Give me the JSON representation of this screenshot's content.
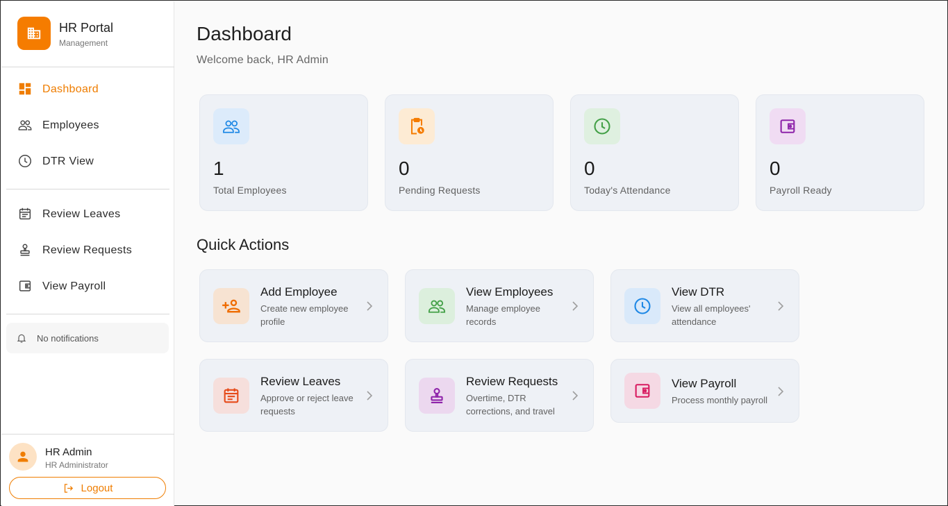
{
  "brand": {
    "title": "HR Portal",
    "subtitle": "Management",
    "color": "#f57c00"
  },
  "nav": {
    "primary": [
      {
        "label": "Dashboard",
        "icon": "dashboard-icon",
        "active": true
      },
      {
        "label": "Employees",
        "icon": "people-icon"
      },
      {
        "label": "DTR View",
        "icon": "clock-icon"
      }
    ],
    "secondary": [
      {
        "label": "Review Leaves",
        "icon": "calendar-icon"
      },
      {
        "label": "Review Requests",
        "icon": "stamp-icon"
      },
      {
        "label": "View Payroll",
        "icon": "wallet-icon"
      }
    ]
  },
  "notifications": {
    "label": "No notifications",
    "icon": "bell-icon"
  },
  "user": {
    "name": "HR Admin",
    "role": "HR Administrator",
    "logout_label": "Logout"
  },
  "header": {
    "title": "Dashboard",
    "subtitle": "Welcome back, HR Admin"
  },
  "stats": [
    {
      "value": "1",
      "label": "Total Employees",
      "icon": "people-icon",
      "color": "#1e88e5"
    },
    {
      "value": "0",
      "label": "Pending Requests",
      "icon": "clipboard-clock-icon",
      "color": "#f57c00"
    },
    {
      "value": "0",
      "label": "Today's Attendance",
      "icon": "clock-icon",
      "color": "#43a047"
    },
    {
      "value": "0",
      "label": "Payroll Ready",
      "icon": "wallet-icon",
      "color": "#8e24aa"
    }
  ],
  "quick_actions": {
    "title": "Quick Actions",
    "items": [
      {
        "title": "Add Employee",
        "desc": "Create new employee profile",
        "icon": "add-person-icon",
        "color": "#ef6c00"
      },
      {
        "title": "View Employees",
        "desc": "Manage employee records",
        "icon": "people-icon",
        "color": "#43a047"
      },
      {
        "title": "View DTR",
        "desc": "View all employees' attendance",
        "icon": "clock-icon",
        "color": "#1e88e5"
      },
      {
        "title": "Review Leaves",
        "desc": "Approve or reject leave requests",
        "icon": "calendar-icon",
        "color": "#e64a19"
      },
      {
        "title": "Review Requests",
        "desc": "Overtime, DTR corrections, and travel",
        "icon": "stamp-icon",
        "color": "#8e24aa"
      },
      {
        "title": "View Payroll",
        "desc": "Process monthly payroll",
        "icon": "wallet-icon",
        "color": "#d81b60"
      }
    ]
  }
}
